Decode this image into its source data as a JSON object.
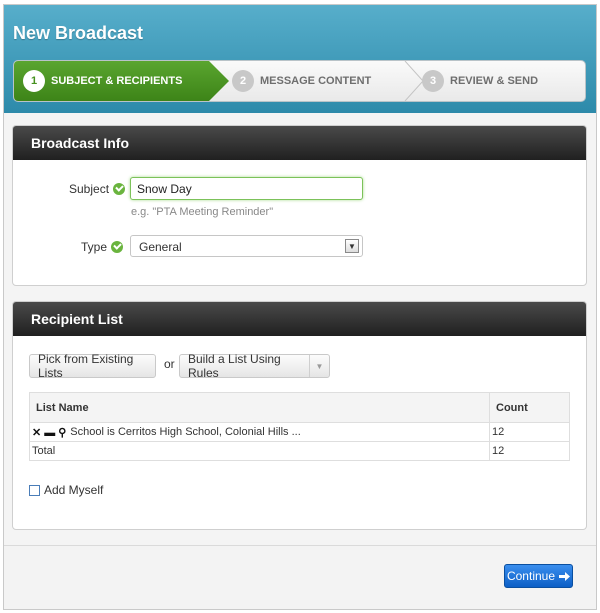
{
  "header": {
    "title": "New Broadcast",
    "steps": [
      {
        "number": "1",
        "label": "SUBJECT & RECIPIENTS",
        "active": true
      },
      {
        "number": "2",
        "label": "MESSAGE CONTENT",
        "active": false
      },
      {
        "number": "3",
        "label": "REVIEW & SEND",
        "active": false
      }
    ]
  },
  "broadcast_info": {
    "heading": "Broadcast Info",
    "subject_label": "Subject",
    "subject_value": "Snow Day",
    "subject_hint": "e.g. \"PTA Meeting Reminder\"",
    "type_label": "Type",
    "type_value": "General"
  },
  "recipient_list": {
    "heading": "Recipient List",
    "pick_button": "Pick from Existing Lists",
    "or_text": "or",
    "build_button": "Build a List Using Rules",
    "table": {
      "col_name": "List Name",
      "col_count": "Count",
      "rows": [
        {
          "name": "School is Cerritos High School, Colonial Hills ...",
          "count": "12"
        }
      ],
      "total_label": "Total",
      "total_count": "12"
    },
    "add_myself": "Add Myself"
  },
  "footer": {
    "continue_button": "Continue"
  },
  "colors": {
    "header_blue": "#3b9abb",
    "step_active_green": "#46911f",
    "success_green": "#6ab43e",
    "continue_blue": "#1a6fd6"
  }
}
